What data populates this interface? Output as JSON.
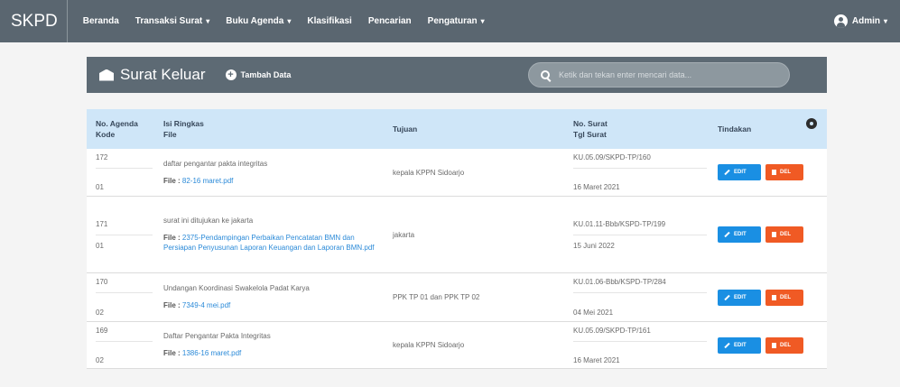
{
  "navbar": {
    "brand": "SKPD",
    "items": [
      {
        "label": "Beranda",
        "caret": false
      },
      {
        "label": "Transaksi Surat",
        "caret": true
      },
      {
        "label": "Buku Agenda",
        "caret": true
      },
      {
        "label": "Klasifikasi",
        "caret": false
      },
      {
        "label": "Pencarian",
        "caret": false
      },
      {
        "label": "Pengaturan",
        "caret": true
      }
    ],
    "user": "Admin",
    "caret_glyph": "▾"
  },
  "panel": {
    "title": "Surat Keluar",
    "add_label": "Tambah Data",
    "search_placeholder": "Ketik dan tekan enter mencari data..."
  },
  "table": {
    "headers": {
      "agenda": "No. Agenda",
      "kode": "Kode",
      "isi": "Isi Ringkas",
      "file": "File",
      "tujuan": "Tujuan",
      "no_surat": "No. Surat",
      "tgl_surat": "Tgl Surat",
      "tindakan": "Tindakan"
    },
    "file_label": "File :",
    "edit_label": "EDIT",
    "delete_label": "DEL",
    "rows": [
      {
        "agenda": "172",
        "kode": "01",
        "isi": "daftar pengantar pakta integritas",
        "file": "82-16 maret.pdf",
        "tujuan": "kepala KPPN Sidoarjo",
        "no_surat": "KU.05.09/SKPD-TP/160",
        "tgl": "16 Maret 2021"
      },
      {
        "agenda": "171",
        "kode": "01",
        "isi": "surat ini ditujukan ke jakarta",
        "file": "2375-Pendampingan Perbaikan Pencatatan BMN dan Persiapan Penyusunan Laporan Keuangan dan Laporan BMN.pdf",
        "tujuan": "jakarta",
        "no_surat": "KU.01.11-Bbb/KSPD-TP/199",
        "tgl": "15 Juni 2022"
      },
      {
        "agenda": "170",
        "kode": "02",
        "isi": "Undangan Koordinasi Swakelola Padat Karya",
        "file": "7349-4 mei.pdf",
        "tujuan": "PPK TP 01 dan PPK TP 02",
        "no_surat": "KU.01.06-Bbb/KSPD-TP/284",
        "tgl": "04 Mei 2021"
      },
      {
        "agenda": "169",
        "kode": "02",
        "isi": "Daftar Pengantar Pakta Integritas",
        "file": "1386-16 maret.pdf",
        "tujuan": "kepala KPPN Sidoarjo",
        "no_surat": "KU.05.09/SKPD-TP/161",
        "tgl": "16 Maret 2021"
      }
    ]
  }
}
